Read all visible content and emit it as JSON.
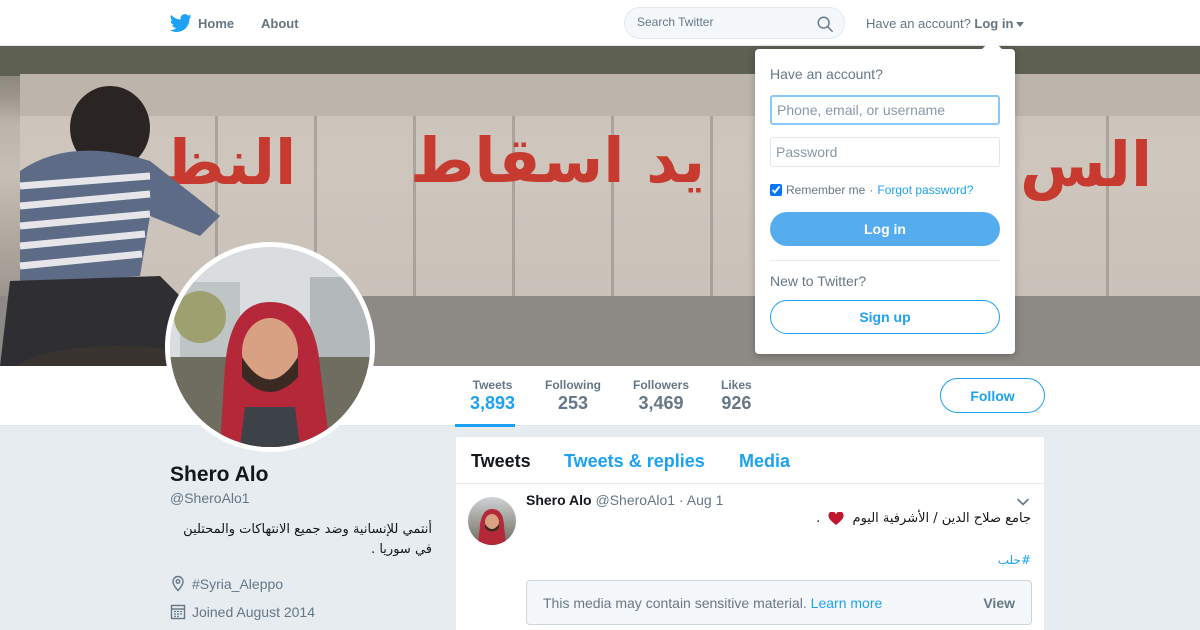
{
  "nav": {
    "home_label": "Home",
    "about_label": "About",
    "search_placeholder": "Search Twitter",
    "have_account": "Have an account?",
    "login_label": "Log in"
  },
  "banner": {
    "graffiti_left": "النظ",
    "graffiti_mid": "يد اسقاط",
    "graffiti_right": "الس"
  },
  "profile": {
    "name": "Shero Alo",
    "handle": "@SheroAlo1",
    "bio": "أنتمي للإنسانية وضد جميع الانتهاكات والمحتلين في سوريا .",
    "location": "#Syria_Aleppo",
    "joined": "Joined August 2014"
  },
  "stats": [
    {
      "label": "Tweets",
      "value": "3,893"
    },
    {
      "label": "Following",
      "value": "253"
    },
    {
      "label": "Followers",
      "value": "3,469"
    },
    {
      "label": "Likes",
      "value": "926"
    }
  ],
  "follow_label": "Follow",
  "timeline": {
    "tabs": [
      "Tweets",
      "Tweets & replies",
      "Media"
    ],
    "tweet": {
      "author": "Shero Alo",
      "handle": "@SheroAlo1",
      "date": "· Aug 1",
      "text": "جامع صلاح الدين / الأشرفية اليوم",
      "punct": ".",
      "hashtag": "#حلب",
      "sensitive_msg": "This media may contain sensitive material.",
      "learn_more": "Learn more",
      "view_label": "View"
    }
  },
  "login_dropdown": {
    "question": "Have an account?",
    "username_placeholder": "Phone, email, or username",
    "password_placeholder": "Password",
    "remember_label": "Remember me",
    "separator": "·",
    "forgot_label": "Forgot password?",
    "login_button": "Log in",
    "new_label": "New to Twitter?",
    "signup_button": "Sign up"
  },
  "colors": {
    "accent": "#1da1f2",
    "login_button": "#55acee",
    "background": "#e6ecf0",
    "heart": "#e0245e"
  },
  "icons": {
    "logo": "twitter-bird-icon",
    "search": "search-icon",
    "location": "location-pin-icon",
    "calendar": "calendar-icon",
    "chevron": "chevron-down-icon",
    "heart": "heart-icon"
  }
}
